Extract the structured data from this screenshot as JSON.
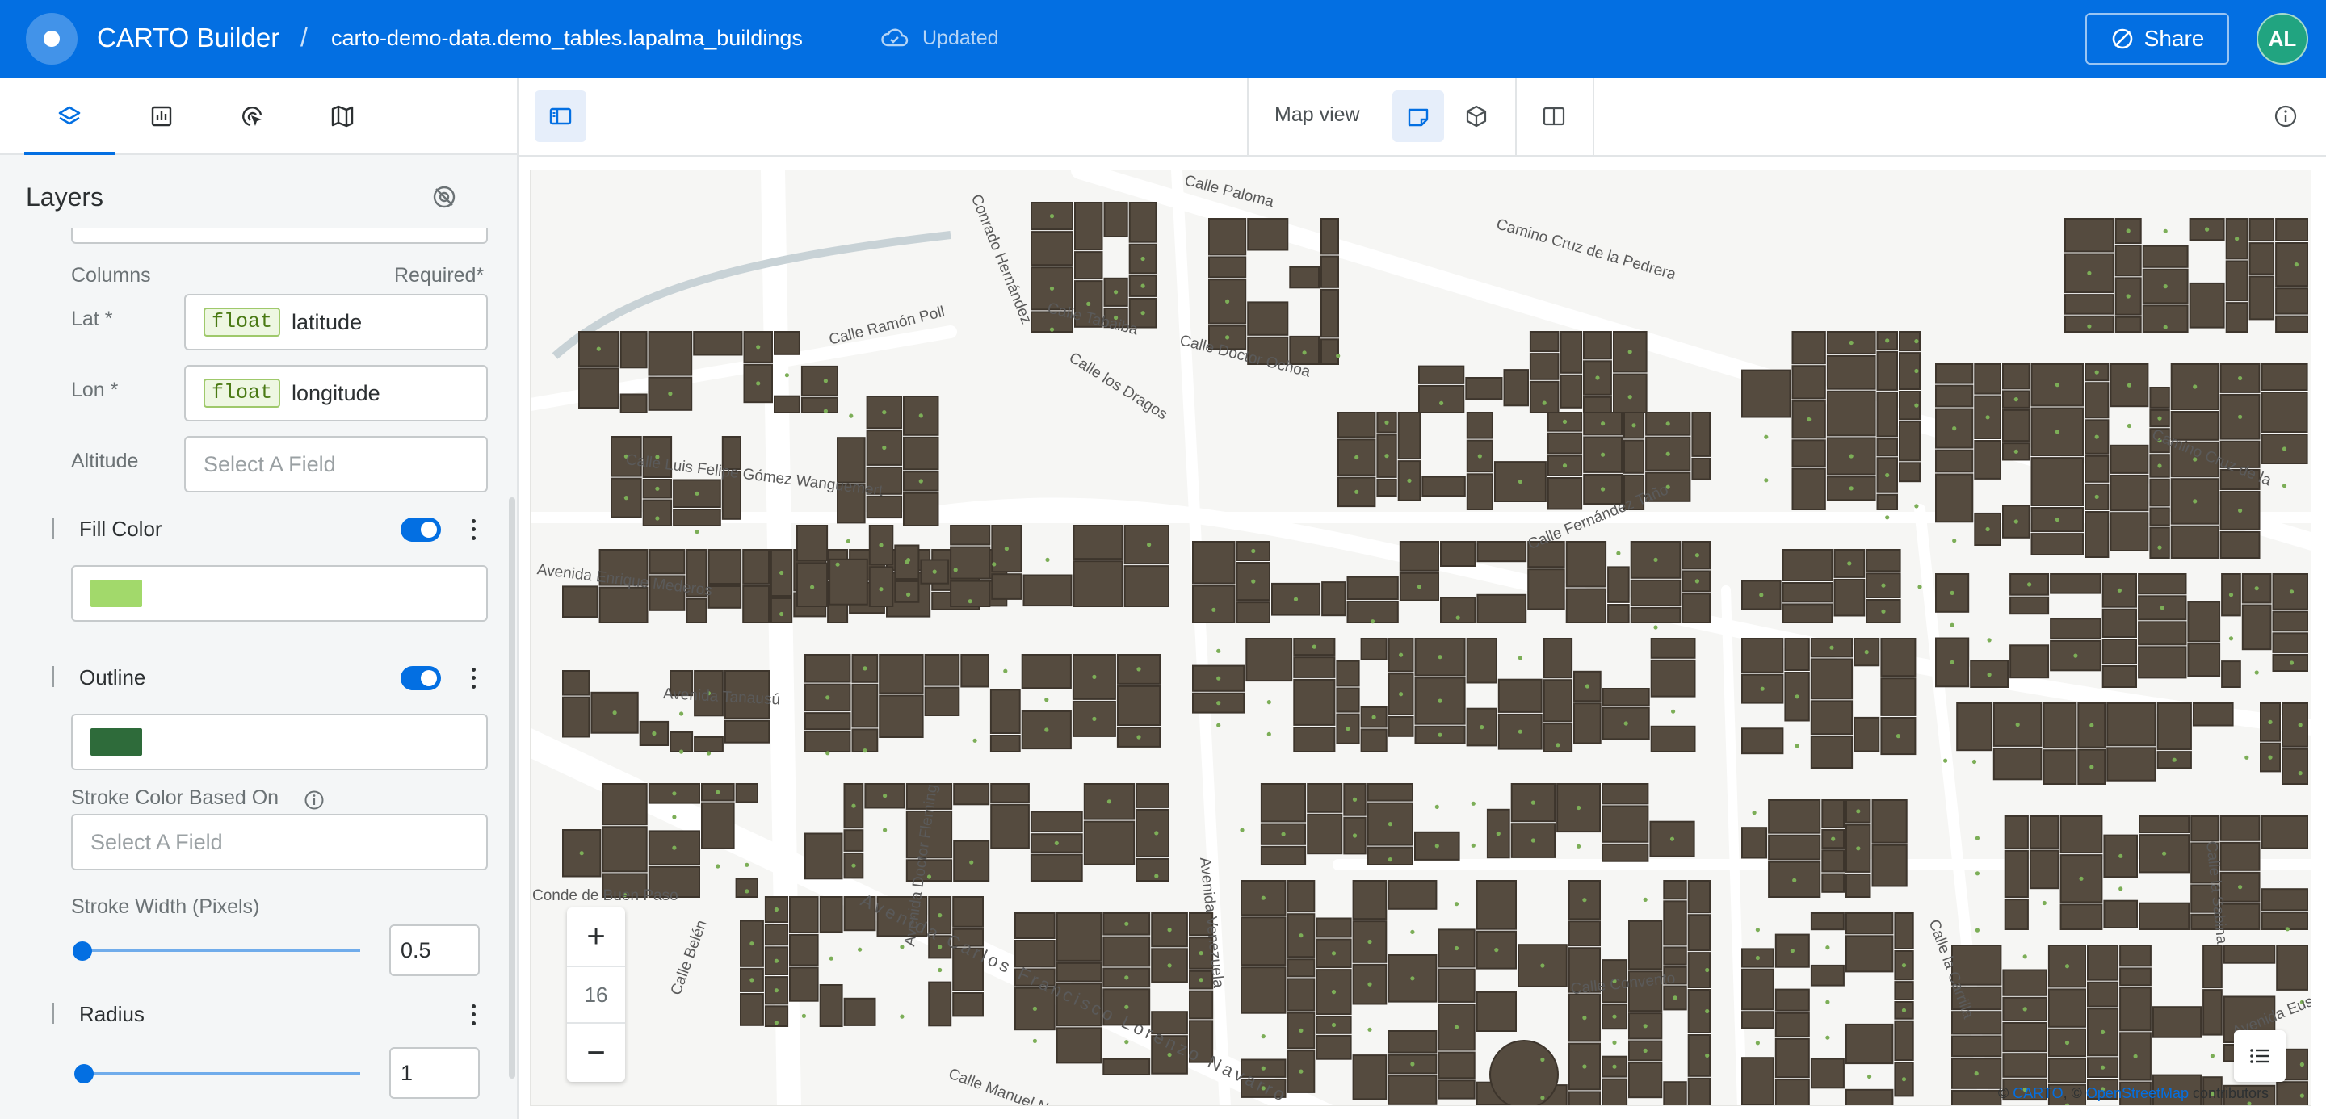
{
  "header": {
    "app_title": "CARTO Builder",
    "separator": "/",
    "dataset": "carto-demo-data.demo_tables.lapalma_buildings",
    "status": "Updated",
    "share_label": "Share",
    "avatar_initials": "AL",
    "accent_color": "#036fe2"
  },
  "left_panel": {
    "tabs": [
      "layers-icon",
      "widgets-icon",
      "interactions-icon",
      "basemap-icon"
    ],
    "title": "Layers",
    "columns_label": "Columns",
    "required_label": "Required*",
    "lat": {
      "label": "Lat *",
      "type": "float",
      "value": "latitude"
    },
    "lon": {
      "label": "Lon *",
      "type": "float",
      "value": "longitude"
    },
    "altitude": {
      "label": "Altitude",
      "placeholder": "Select A Field"
    },
    "fill_color": {
      "title": "Fill Color",
      "enabled": true,
      "color": "#a2d96b"
    },
    "outline": {
      "title": "Outline",
      "enabled": true,
      "color": "#2e6b3a"
    },
    "stroke_color_based_on": {
      "label": "Stroke Color Based On",
      "placeholder": "Select A Field"
    },
    "stroke_width": {
      "label": "Stroke Width (Pixels)",
      "value": "0.5"
    },
    "radius": {
      "title": "Radius",
      "value": "1"
    }
  },
  "map_header": {
    "map_view_label": "Map view"
  },
  "map": {
    "zoom_level": "16",
    "zoom_in": "+",
    "zoom_out": "−",
    "attribution": {
      "prefix": "©",
      "carto": "CARTO",
      "mid": ", ©",
      "osm": "OpenStreetMap",
      "suffix": "contributors"
    },
    "street_labels": [
      "Calle Paloma",
      "Camino Cruz de la Pedrera",
      "Conrado Hernández",
      "Calle Tabaiba",
      "Calle Ramón Poll",
      "Calle Doctor Ochoa",
      "Calle los Dragos",
      "Calle Luis Felipe Gómez Wanguemert",
      "Avenida Enrique Mederos",
      "Avenida Tanausú",
      "Avenida Doctor Fleming",
      "Avenida Carlos Francisco Lorenzo Navarro",
      "Avenida Venezuela",
      "Calle Belén",
      "Calle Manuel Nazco",
      "Calle Convento",
      "Camino Cruz de la",
      "Calle la Sabina",
      "Calle la Carrilla",
      "Calle Fernández Taño",
      "Conde de Buen Paso",
      "Avenida Euseb"
    ]
  }
}
